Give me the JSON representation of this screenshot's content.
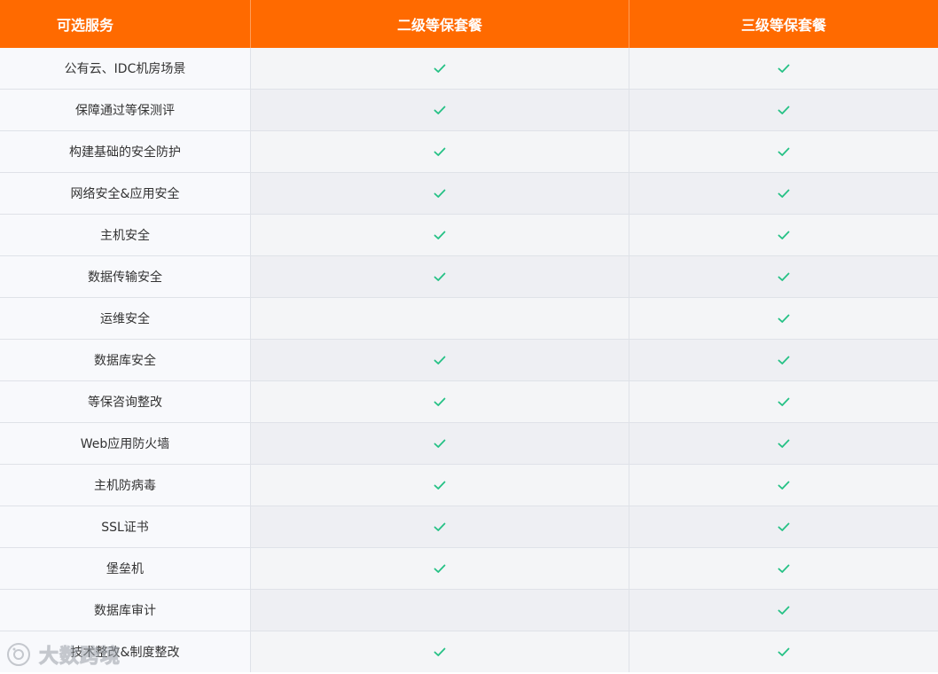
{
  "table": {
    "headers": [
      "可选服务",
      "二级等保套餐",
      "三级等保套餐"
    ],
    "rows": [
      {
        "service": "公有云、IDC机房场景",
        "level2": true,
        "level3": true
      },
      {
        "service": "保障通过等保测评",
        "level2": true,
        "level3": true
      },
      {
        "service": "构建基础的安全防护",
        "level2": true,
        "level3": true
      },
      {
        "service": "网络安全&应用安全",
        "level2": true,
        "level3": true
      },
      {
        "service": "主机安全",
        "level2": true,
        "level3": true
      },
      {
        "service": "数据传输安全",
        "level2": true,
        "level3": true
      },
      {
        "service": "运维安全",
        "level2": false,
        "level3": true
      },
      {
        "service": "数据库安全",
        "level2": true,
        "level3": true
      },
      {
        "service": "等保咨询整改",
        "level2": true,
        "level3": true
      },
      {
        "service": "Web应用防火墙",
        "level2": true,
        "level3": true
      },
      {
        "service": "主机防病毒",
        "level2": true,
        "level3": true
      },
      {
        "service": "SSL证书",
        "level2": true,
        "level3": true
      },
      {
        "service": "堡垒机",
        "level2": true,
        "level3": true
      },
      {
        "service": "数据库审计",
        "level2": false,
        "level3": true
      },
      {
        "service": "技术整改&制度整改",
        "level2": true,
        "level3": true
      }
    ]
  },
  "icons": {
    "included": "check-icon",
    "watermark": "camera-icon"
  },
  "watermark": {
    "text": "大数跨境"
  },
  "colors": {
    "header_bg": "#ff6a00",
    "header_text": "#ffffff",
    "check": "#25c185",
    "text": "#333333",
    "border": "#dfe2e8"
  }
}
